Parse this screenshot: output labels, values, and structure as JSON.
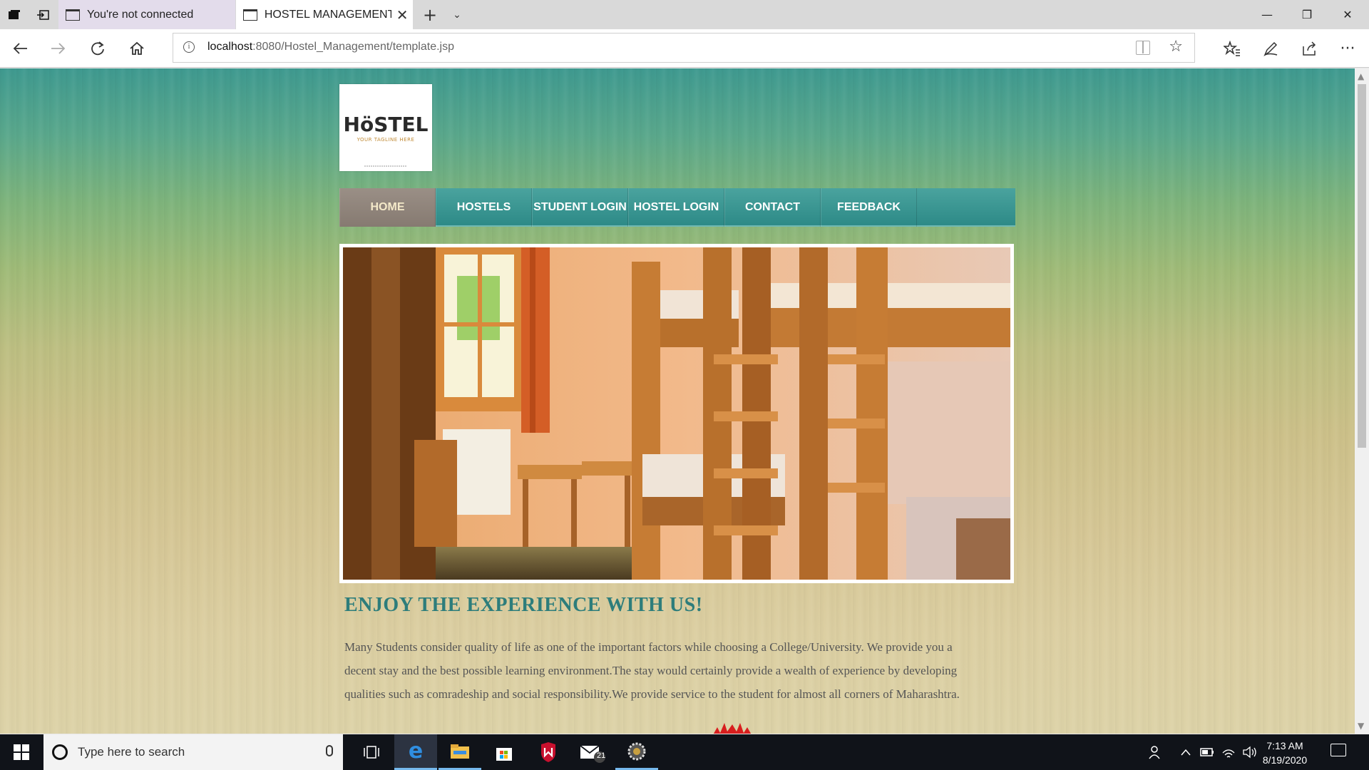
{
  "browser": {
    "tabs": [
      {
        "label": "You're not connected",
        "active": false
      },
      {
        "label": "HOSTEL MANAGEMENT",
        "active": true
      }
    ],
    "new_tab": "+",
    "tab_list": "⌄",
    "window_controls": {
      "minimize": "—",
      "restore": "❐",
      "close": "✕"
    },
    "url_host": "localhost",
    "url_rest": ":8080/Hostel_Management/template.jsp",
    "nav_icons": [
      "back-icon",
      "forward-icon",
      "refresh-icon",
      "home-icon"
    ],
    "toolbar_icons": [
      "favorites-icon",
      "notes-icon",
      "share-icon",
      "more-icon"
    ],
    "more_label": "···"
  },
  "page": {
    "logo": {
      "word": "HöSTEL",
      "tagline": "YOUR TAGLINE HERE"
    },
    "menu": [
      {
        "label": "HOME",
        "active": true
      },
      {
        "label": "HOSTELS",
        "active": false
      },
      {
        "label": "STUDENT LOGIN",
        "active": false
      },
      {
        "label": "HOSTEL LOGIN",
        "active": false
      },
      {
        "label": "CONTACT",
        "active": false
      },
      {
        "label": "FEEDBACK",
        "active": false
      }
    ],
    "heading": "ENJOY THE EXPERIENCE WITH US!",
    "paragraph": "Many Students consider quality of life as one of the important factors while choosing a College/University. We provide you a decent stay and the best possible learning environment.The stay would certainly provide a wealth of experience by developing qualities such as comradeship and social responsibility.We provide service to the student for almost all corners of Maharashtra."
  },
  "taskbar": {
    "search_placeholder": "Type here to search",
    "mail_badge": "21",
    "time": "7:13 AM",
    "date": "8/19/2020"
  },
  "colors": {
    "menu_teal": "#2d8a87",
    "menu_active": "#867a71",
    "heading": "#2d7d7b"
  }
}
